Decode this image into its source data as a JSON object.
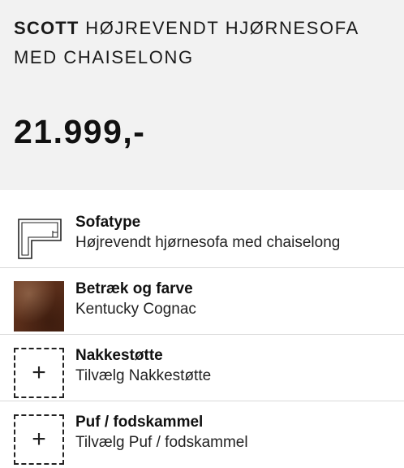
{
  "product": {
    "brand": "SCOTT",
    "name": "HØJREVENDT HJØRNESOFA MED CHAISELONG",
    "price": "21.999,-"
  },
  "options": [
    {
      "title": "Sofatype",
      "value": "Højrevendt hjørnesofa med chaiselong",
      "icon": "corner-sofa-icon"
    },
    {
      "title": "Betræk og farve",
      "value": "Kentucky Cognac",
      "icon": "leather-swatch"
    },
    {
      "title": "Nakkestøtte",
      "value": "Tilvælg Nakkestøtte",
      "icon": "plus-icon"
    },
    {
      "title": "Puf / fodskammel",
      "value": "Tilvælg Puf / fodskammel",
      "icon": "plus-icon"
    }
  ],
  "colors": {
    "header_bg": "#f2f2f2",
    "swatch": "#5a2e1a",
    "divider": "#d9d9d9"
  }
}
